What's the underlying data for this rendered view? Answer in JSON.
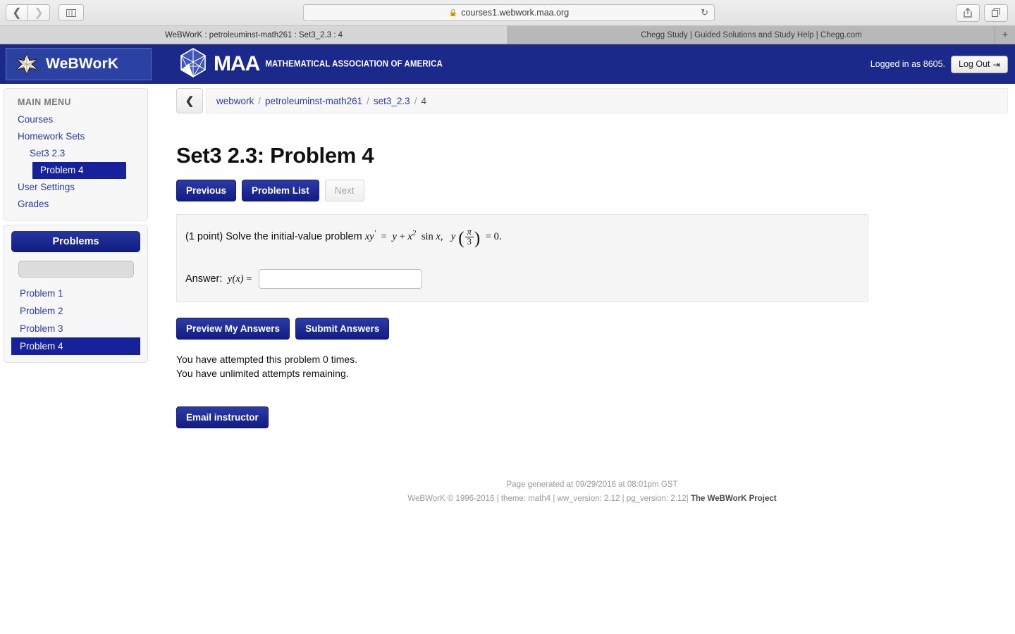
{
  "browser": {
    "url": "courses1.webwork.maa.org",
    "lock_icon": "lock-icon",
    "reload_icon": "reload-icon",
    "back_icon": "chevron-left-icon",
    "forward_icon": "chevron-right-icon",
    "sidebar_icon": "sidebar-toggle-icon",
    "share_icon": "share-icon",
    "tabs_icon": "show-tabs-icon",
    "new_tab_label": "+",
    "tabs": [
      {
        "title": "WeBWorK : petroleuminst-math261 : Set3_2.3 : 4",
        "active": true
      },
      {
        "title": "Chegg Study | Guided Solutions and Study Help | Chegg.com",
        "active": false
      }
    ]
  },
  "header": {
    "logo_text": "WeBWorK",
    "logo_icon": "webwork-star-icon",
    "maa_icon": "maa-polyhedron-icon",
    "maa_text": "MAA",
    "maa_subtitle": "MATHEMATICAL ASSOCIATION OF AMERICA",
    "logged_in": "Logged in as 8605.",
    "logout_label": "Log Out",
    "logout_icon": "logout-arrow-icon",
    "bg_color": "#1b2a8a"
  },
  "sidebar": {
    "menu_title": "MAIN MENU",
    "items": [
      {
        "label": "Courses",
        "level": 0,
        "active": false
      },
      {
        "label": "Homework Sets",
        "level": 0,
        "active": false
      },
      {
        "label": "Set3 2.3",
        "level": 1,
        "active": false
      },
      {
        "label": "Problem 4",
        "level": 2,
        "active": true
      },
      {
        "label": "User Settings",
        "level": 0,
        "active": false
      },
      {
        "label": "Grades",
        "level": 0,
        "active": false
      }
    ],
    "problems_title": "Problems",
    "jump_value": "",
    "problems": [
      {
        "label": "Problem 1",
        "active": false
      },
      {
        "label": "Problem 2",
        "active": false
      },
      {
        "label": "Problem 3",
        "active": false
      },
      {
        "label": "Problem 4",
        "active": true
      }
    ]
  },
  "breadcrumb": {
    "back_icon": "chevron-left-icon",
    "crumbs": [
      "webwork",
      "petroleuminst-math261",
      "set3_2.3",
      "4"
    ],
    "separator": "/"
  },
  "main": {
    "page_title": "Set3 2.3: Problem 4",
    "nav_buttons": [
      {
        "label": "Previous",
        "disabled": false
      },
      {
        "label": "Problem List",
        "disabled": false
      },
      {
        "label": "Next",
        "disabled": true
      }
    ],
    "problem": {
      "points": "(1 point)",
      "prompt": "Solve the initial-value problem",
      "equation_text": "xy′ = y + x² sin x,  y(π/3) = 0.",
      "answer_label_prefix": "Answer:",
      "answer_label_fn": "y(x) =",
      "answer_value": "",
      "answer_placeholder": ""
    },
    "action_buttons": [
      {
        "label": "Preview My Answers"
      },
      {
        "label": "Submit Answers"
      }
    ],
    "attempts_line1": "You have attempted this problem 0 times.",
    "attempts_line2": "You have unlimited attempts remaining.",
    "email_button": "Email instructor"
  },
  "footer": {
    "generated": "Page generated at 09/29/2016 at 08:01pm GST",
    "copyright": "WeBWorK © 1996-2016 | theme: math4 | ww_version: 2.12 | pg_version: 2.12|",
    "project": "The WeBWorK Project"
  }
}
